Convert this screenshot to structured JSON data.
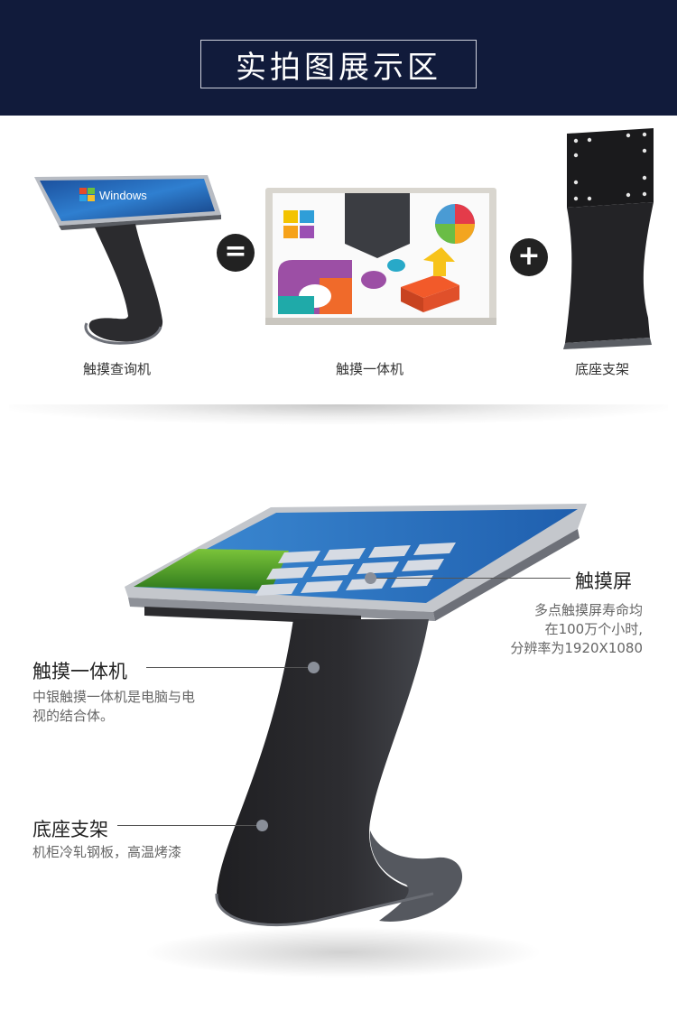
{
  "header": {
    "title": "实拍图展示区"
  },
  "equation": {
    "item1": "触摸查询机",
    "equals": "=",
    "item2": "触摸一体机",
    "plus": "+",
    "item3": "底座支架",
    "screen_brand": "Windows",
    "icons": [
      "equals-icon",
      "plus-icon"
    ]
  },
  "callouts": {
    "screen": {
      "title": "触摸屏",
      "desc_line1": "多点触摸屏寿命均",
      "desc_line2": "在100万个小时,",
      "desc_line3": "分辨率为1920X1080"
    },
    "aio": {
      "title": "触摸一体机",
      "desc_line1": "中银触摸一体机是电脑与电",
      "desc_line2": "视的结合体。"
    },
    "stand": {
      "title": "底座支架",
      "desc_line1": "机柜冷轧钢板，高温烤漆"
    }
  },
  "colors": {
    "header_bg": "#111b3b",
    "kiosk_body": "#2b2b2e",
    "dot": "#8a8f99"
  }
}
